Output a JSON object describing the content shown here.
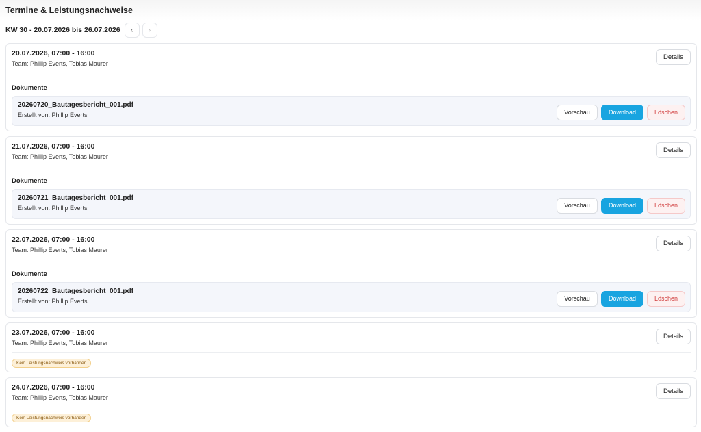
{
  "header": {
    "title": "Termine & Leistungsnachweise",
    "week_label": "KW 30 - 20.07.2026 bis 26.07.2026",
    "prev_icon": "‹",
    "next_icon": "›"
  },
  "labels": {
    "details": "Details",
    "documents": "Dokumente",
    "preview": "Vorschau",
    "download": "Download",
    "delete": "Löschen",
    "no_proof": "Kein Leistungsnachweis vorhanden"
  },
  "colors": {
    "download": "#18a4e0",
    "delete_text": "#d24343",
    "badge_bg": "#fdf0d8"
  },
  "entries": [
    {
      "date": "20.07.2026, 07:00 - 16:00",
      "team": "Team: Phillip Everts, Tobias Maurer",
      "document": {
        "name": "20260720_Bautagesbericht_001.pdf",
        "author": "Erstellt von: Phillip Everts"
      }
    },
    {
      "date": "21.07.2026, 07:00 - 16:00",
      "team": "Team: Phillip Everts, Tobias Maurer",
      "document": {
        "name": "20260721_Bautagesbericht_001.pdf",
        "author": "Erstellt von: Phillip Everts"
      }
    },
    {
      "date": "22.07.2026, 07:00 - 16:00",
      "team": "Team: Phillip Everts, Tobias Maurer",
      "document": {
        "name": "20260722_Bautagesbericht_001.pdf",
        "author": "Erstellt von: Phillip Everts"
      }
    },
    {
      "date": "23.07.2026, 07:00 - 16:00",
      "team": "Team: Phillip Everts, Tobias Maurer"
    },
    {
      "date": "24.07.2026, 07:00 - 16:00",
      "team": "Team: Phillip Everts, Tobias Maurer"
    }
  ]
}
